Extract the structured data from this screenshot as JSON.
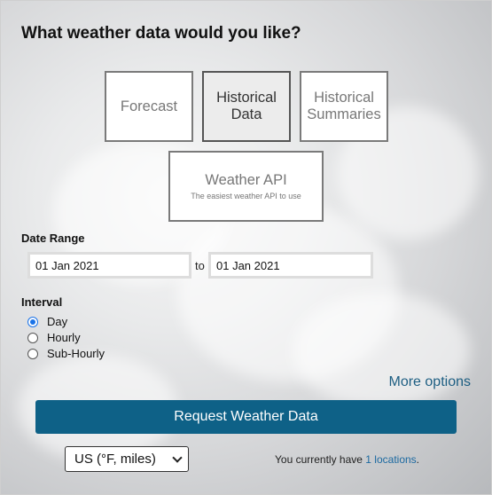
{
  "heading": "What weather data would you like?",
  "tiles": {
    "forecast": "Forecast",
    "historical_line1": "Historical",
    "historical_line2": "Data",
    "summaries_line1": "Historical",
    "summaries_line2": "Summaries",
    "api_title": "Weather API",
    "api_subtitle": "The easiest weather API to use"
  },
  "date_range": {
    "label": "Date Range",
    "start": "01 Jan 2021",
    "separator": "to",
    "end": "01 Jan 2021"
  },
  "interval": {
    "label": "Interval",
    "options": [
      "Day",
      "Hourly",
      "Sub-Hourly"
    ],
    "selected": "Day"
  },
  "more_options": "More options",
  "request_button": "Request Weather Data",
  "units": {
    "selected": "US (°F, miles)"
  },
  "locations": {
    "prefix": "You currently have",
    "link": "1 locations",
    "suffix": "."
  },
  "colors": {
    "accent": "#0e6187",
    "link": "#1d5e82",
    "radio": "#1a73e8"
  }
}
